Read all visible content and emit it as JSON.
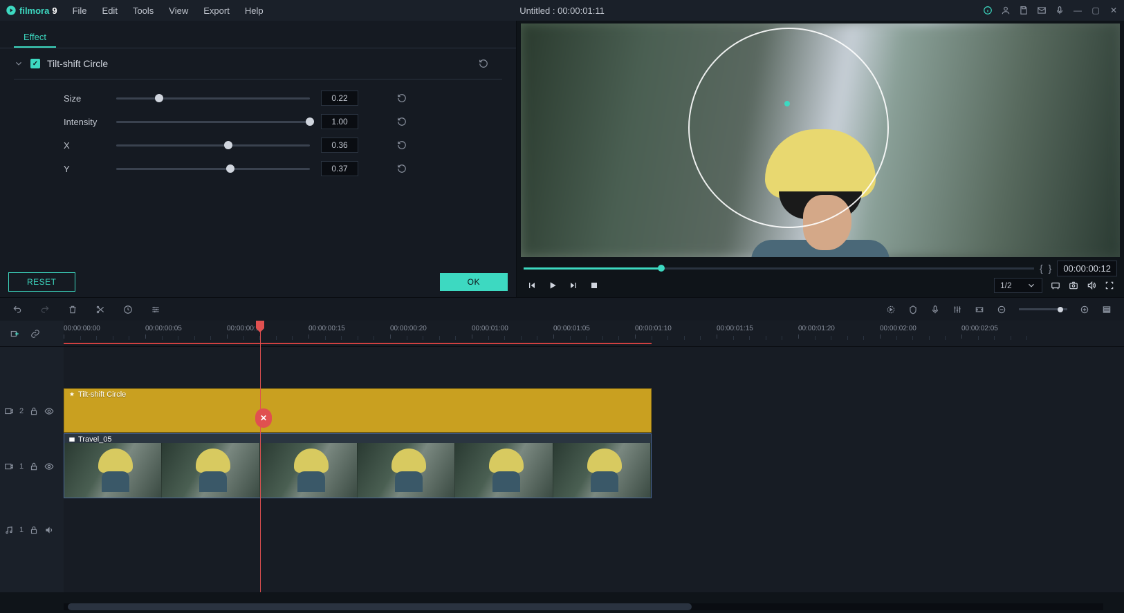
{
  "app": {
    "logo_text": "filmora",
    "logo_suffix": "9"
  },
  "menu": [
    "File",
    "Edit",
    "Tools",
    "View",
    "Export",
    "Help"
  ],
  "title": "Untitled : 00:00:01:11",
  "effect_panel": {
    "tab": "Effect",
    "title": "Tilt-shift Circle",
    "sliders": [
      {
        "label": "Size",
        "value": "0.22",
        "pos": 22
      },
      {
        "label": "Intensity",
        "value": "1.00",
        "pos": 100
      },
      {
        "label": "X",
        "value": "0.36",
        "pos": 58
      },
      {
        "label": "Y",
        "value": "0.37",
        "pos": 59
      }
    ],
    "reset": "RESET",
    "ok": "OK"
  },
  "preview": {
    "timecode": "00:00:00:12",
    "zoom": "1/2"
  },
  "ruler": [
    "00:00:00:00",
    "00:00:00:05",
    "00:00:00:10",
    "00:00:00:15",
    "00:00:00:20",
    "00:00:01:00",
    "00:00:01:05",
    "00:00:01:10",
    "00:00:01:15",
    "00:00:01:20",
    "00:00:02:00",
    "00:00:02:05"
  ],
  "tracks": {
    "effect_clip": "Tilt-shift Circle",
    "video_clip": "Travel_05",
    "track2_num": "2",
    "track1_num": "1",
    "audio_num": "1"
  }
}
